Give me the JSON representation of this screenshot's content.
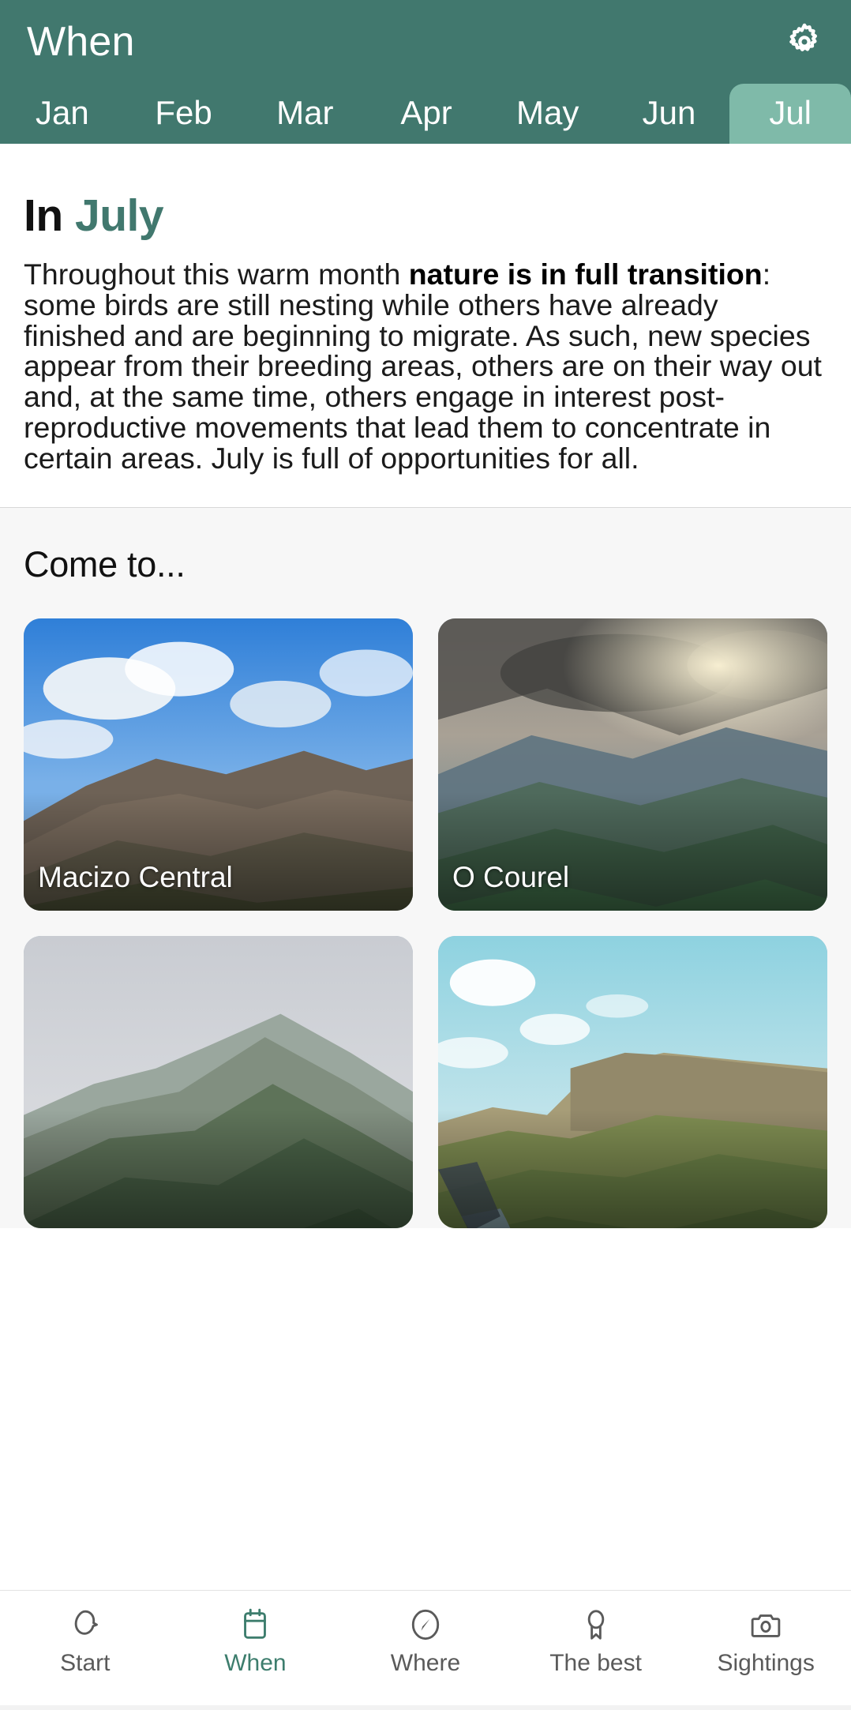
{
  "header": {
    "title": "When",
    "settings_icon": "gear-icon",
    "months": [
      {
        "label": "Jan",
        "active": false
      },
      {
        "label": "Feb",
        "active": false
      },
      {
        "label": "Mar",
        "active": false
      },
      {
        "label": "Apr",
        "active": false
      },
      {
        "label": "May",
        "active": false
      },
      {
        "label": "Jun",
        "active": false
      },
      {
        "label": "Jul",
        "active": true
      }
    ],
    "bg_color": "#41786e",
    "active_tab_color": "#7fbaa9"
  },
  "article": {
    "heading_prefix": "In",
    "heading_month": "July",
    "accent_color": "#41786e",
    "body_part1": "Throughout this warm month ",
    "body_bold": "nature is in full transition",
    "body_part2": ": some birds are still nesting while others have already finished and are beginning to migrate. As such, new species appear from their breeding areas, others are on their way out and, at the same time, others engage in interest post-reproductive movements that lead them to concentrate in certain areas. July is full of opportunities for all."
  },
  "come_to": {
    "title": "Come to...",
    "cards": [
      {
        "label": "Macizo Central"
      },
      {
        "label": "O Courel"
      },
      {
        "label": ""
      },
      {
        "label": ""
      }
    ]
  },
  "bottom_nav": {
    "items": [
      {
        "label": "Start",
        "icon": "bird-icon",
        "active": false
      },
      {
        "label": "When",
        "icon": "calendar-icon",
        "active": true
      },
      {
        "label": "Where",
        "icon": "compass-icon",
        "active": false
      },
      {
        "label": "The best",
        "icon": "award-icon",
        "active": false
      },
      {
        "label": "Sightings",
        "icon": "camera-icon",
        "active": false
      }
    ],
    "active_color": "#3d7d6d",
    "inactive_color": "#5a5a5a"
  }
}
